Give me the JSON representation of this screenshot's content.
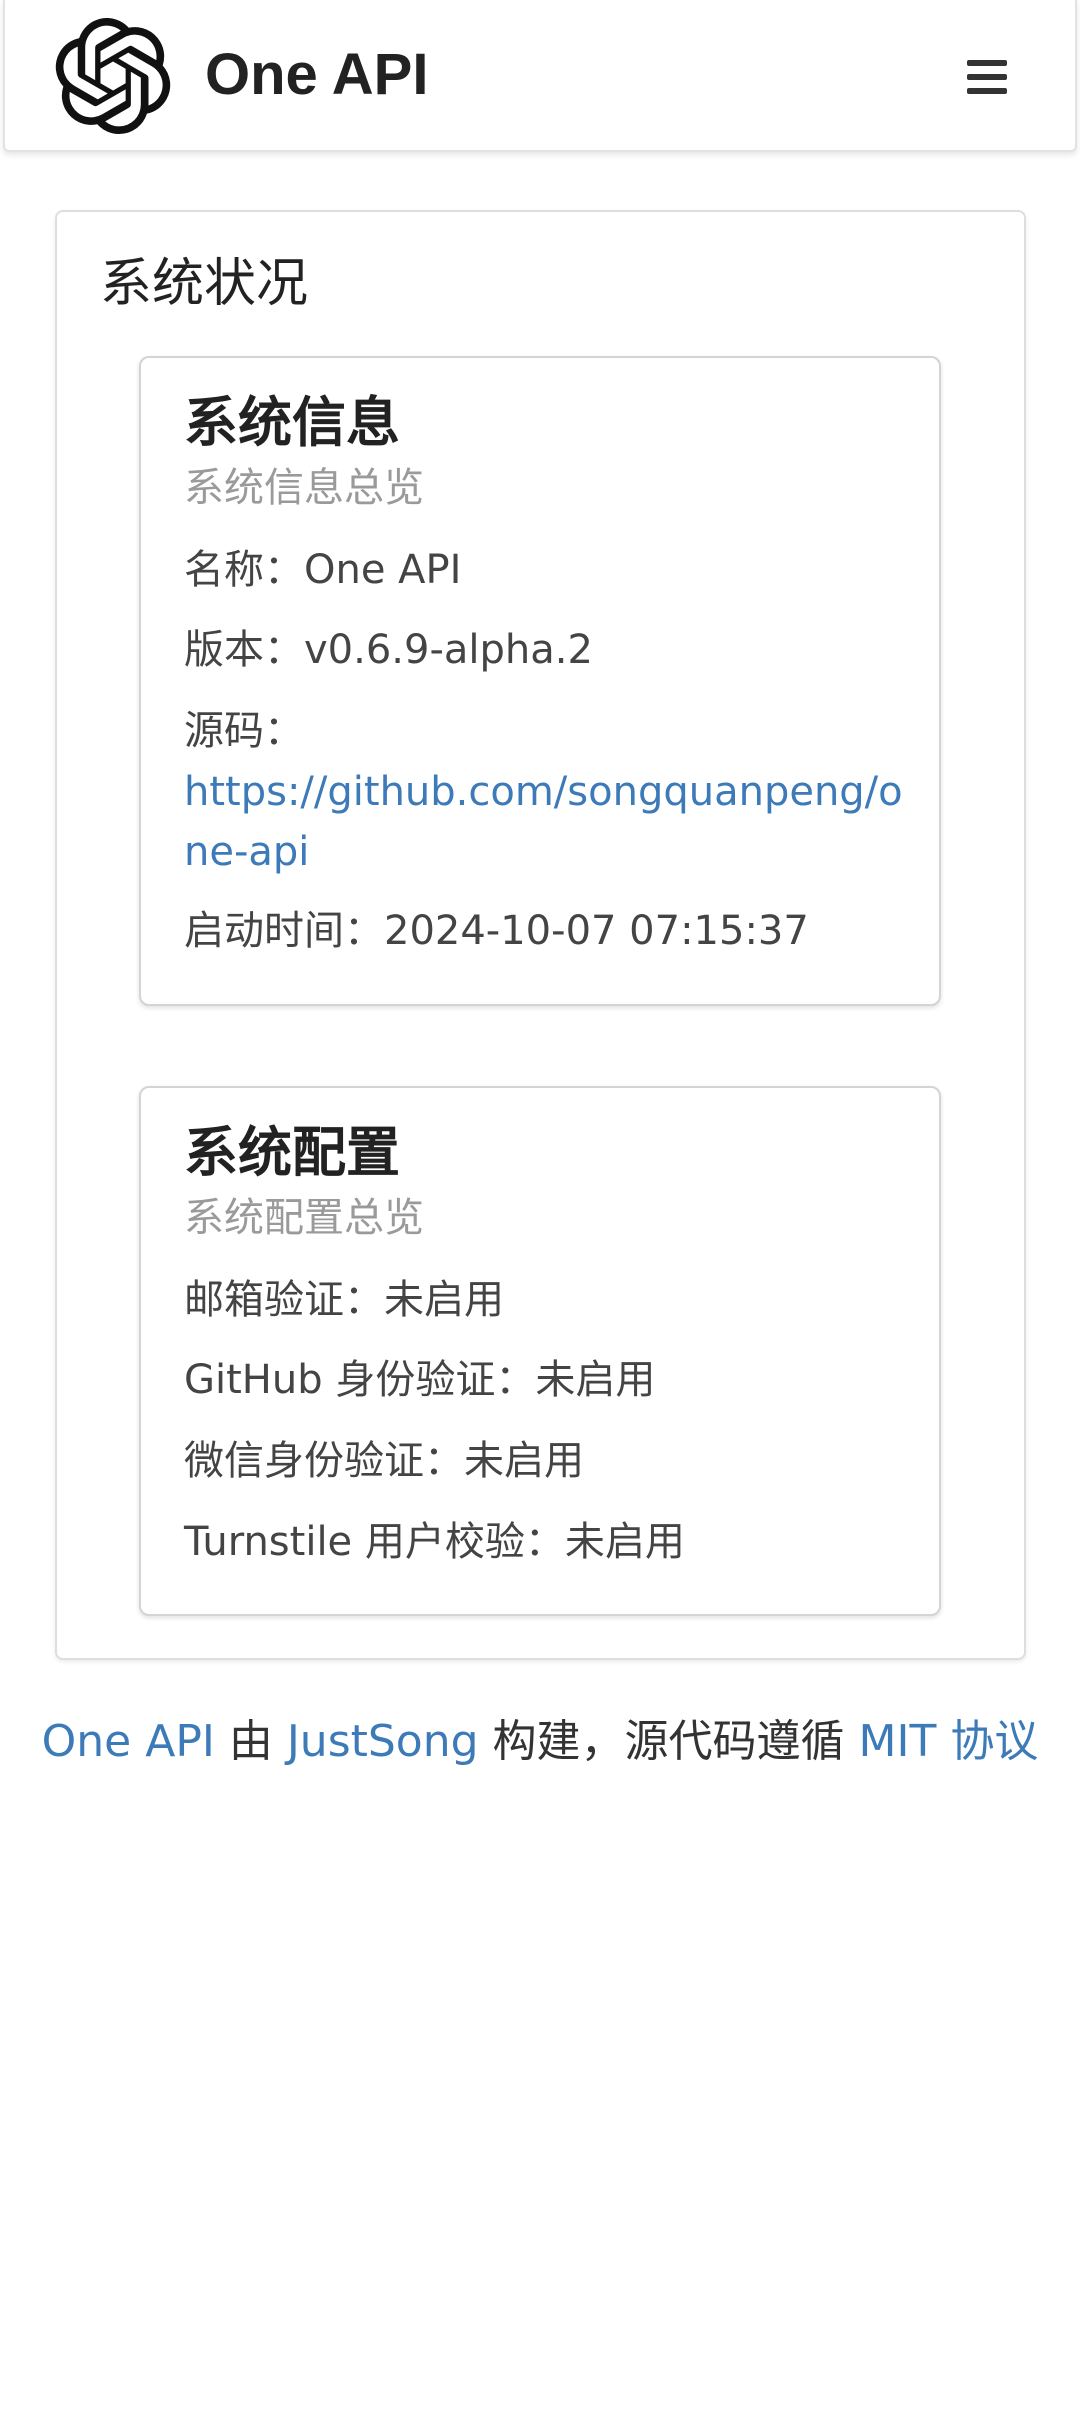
{
  "header": {
    "title": "One API",
    "logo_icon": "openai-logo-icon",
    "menu_icon": "hamburger-menu-icon"
  },
  "status": {
    "title": "系统状况"
  },
  "system_info": {
    "title": "系统信息",
    "subtitle": "系统信息总览",
    "name_label": "名称：",
    "name_value": "One API",
    "version_label": "版本：",
    "version_value": "v0.6.9-alpha.2",
    "source_label": "源码：",
    "source_url": "https://github.com/songquanpeng/one-api",
    "start_time_label": "启动时间：",
    "start_time_value": "2024-10-07 07:15:37"
  },
  "system_config": {
    "title": "系统配置",
    "subtitle": "系统配置总览",
    "email_label": "邮箱验证：",
    "email_value": "未启用",
    "github_label": "GitHub 身份验证：",
    "github_value": "未启用",
    "wechat_label": "微信身份验证：",
    "wechat_value": "未启用",
    "turnstile_label": "Turnstile 用户校验：",
    "turnstile_value": "未启用"
  },
  "footer": {
    "project_link": "One API",
    "by_text": " 由 ",
    "author_link": "JustSong",
    "middle_text": " 构建，源代码遵循 ",
    "license_link": "MIT 协议"
  },
  "colors": {
    "link": "#3d7ab8",
    "subtitle": "#9a9a9a",
    "text": "#444444"
  }
}
